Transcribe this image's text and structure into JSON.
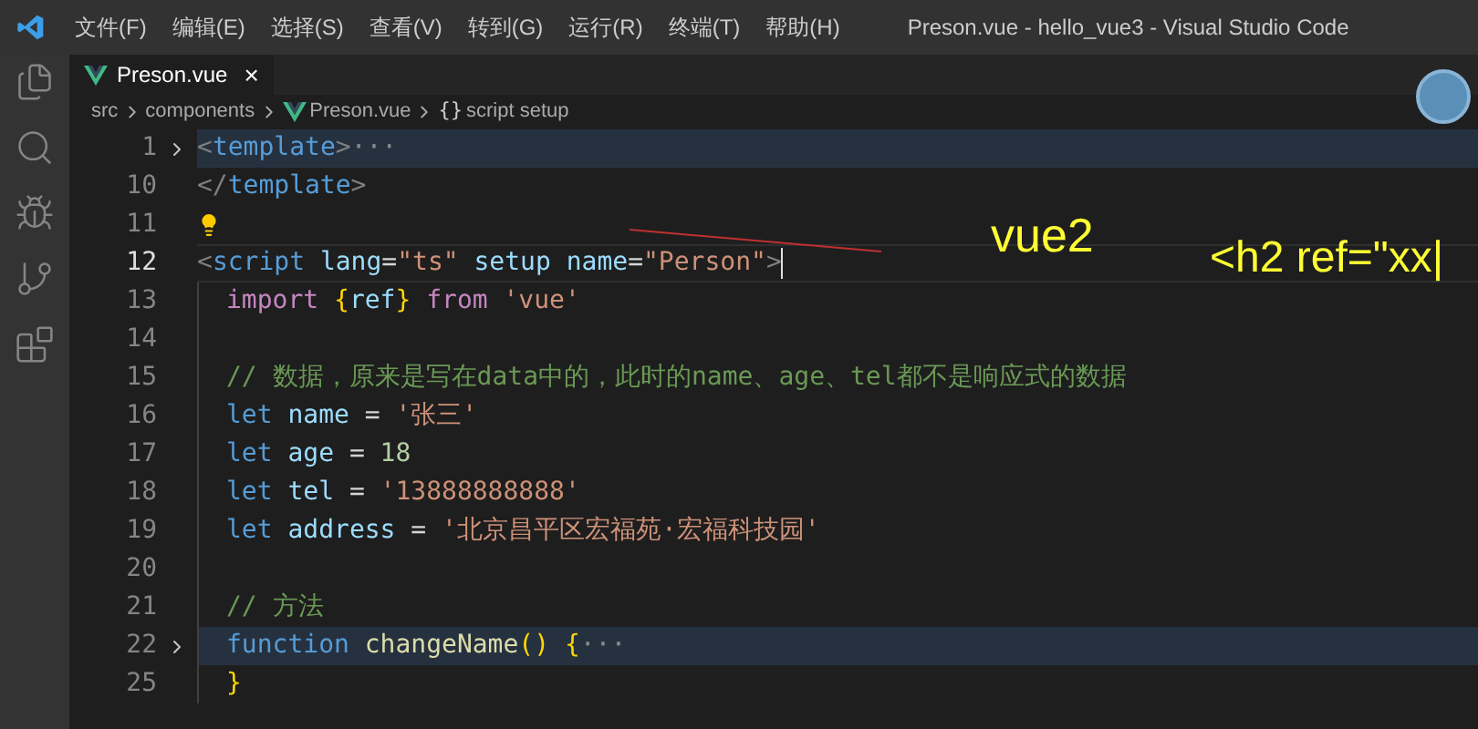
{
  "menu": [
    "文件(F)",
    "编辑(E)",
    "选择(S)",
    "查看(V)",
    "转到(G)",
    "运行(R)",
    "终端(T)",
    "帮助(H)"
  ],
  "window": {
    "title": "Preson.vue - hello_vue3 - Visual Studio Code"
  },
  "tabs": [
    {
      "label": "Preson.vue",
      "selected": true,
      "close": "×"
    }
  ],
  "breadcrumb": [
    {
      "kind": "folder",
      "label": "src"
    },
    {
      "kind": "folder",
      "label": "components"
    },
    {
      "kind": "vue",
      "label": "Preson.vue"
    },
    {
      "kind": "symbol",
      "label": "script setup",
      "glyph": "{}"
    }
  ],
  "lines": [
    {
      "number": "1",
      "fold": true,
      "current": false,
      "indent": false,
      "bulb": false,
      "tokens": [
        {
          "kind": "punct",
          "text": "<"
        },
        {
          "kind": "tag",
          "text": "template"
        },
        {
          "kind": "punct",
          "text": ">"
        },
        {
          "kind": "ellipsis",
          "text": "···"
        }
      ]
    },
    {
      "number": "10",
      "fold": false,
      "current": false,
      "indent": false,
      "bulb": false,
      "tokens": [
        {
          "kind": "punct",
          "text": "</"
        },
        {
          "kind": "tag",
          "text": "template"
        },
        {
          "kind": "punct",
          "text": ">"
        }
      ]
    },
    {
      "number": "11",
      "fold": false,
      "current": false,
      "indent": false,
      "bulb": true
    },
    {
      "number": "12",
      "fold": false,
      "current": true,
      "indent": false,
      "bulb": false,
      "tokens": [
        {
          "kind": "punct",
          "text": "<"
        },
        {
          "kind": "tag",
          "text": "script"
        },
        {
          "kind": "attr",
          "text": " lang"
        },
        {
          "kind": "plain",
          "text": "="
        },
        {
          "kind": "string",
          "text": "\"ts\""
        },
        {
          "kind": "attr",
          "text": " setup"
        },
        {
          "kind": "attr",
          "text": " name"
        },
        {
          "kind": "plain",
          "text": "="
        },
        {
          "kind": "string",
          "text": "\"Person\""
        },
        {
          "kind": "punct",
          "text": ">"
        }
      ]
    },
    {
      "number": "13",
      "fold": false,
      "current": false,
      "indent": true,
      "bulb": false,
      "tokens": [
        {
          "kind": "keyword",
          "text": "import"
        },
        {
          "kind": "bracket",
          "text": " {"
        },
        {
          "kind": "var",
          "text": "ref"
        },
        {
          "kind": "bracket",
          "text": "}"
        },
        {
          "kind": "keyword",
          "text": " from"
        },
        {
          "kind": "string",
          "text": " 'vue'"
        }
      ]
    },
    {
      "number": "14",
      "fold": false,
      "current": false,
      "indent": true,
      "bulb": false
    },
    {
      "number": "15",
      "fold": false,
      "current": false,
      "indent": true,
      "bulb": false,
      "tokens": [
        {
          "kind": "comment",
          "text": "// 数据，原来是写在data中的，此时的name、age、tel都不是响应式的数据"
        }
      ]
    },
    {
      "number": "16",
      "fold": false,
      "current": false,
      "indent": true,
      "bulb": false,
      "tokens": [
        {
          "kind": "storage",
          "text": "let"
        },
        {
          "kind": "var",
          "text": " name"
        },
        {
          "kind": "plain",
          "text": " ="
        },
        {
          "kind": "string",
          "text": " '张三'"
        }
      ]
    },
    {
      "number": "17",
      "fold": false,
      "current": false,
      "indent": true,
      "bulb": false,
      "tokens": [
        {
          "kind": "storage",
          "text": "let"
        },
        {
          "kind": "var",
          "text": " age"
        },
        {
          "kind": "plain",
          "text": " ="
        },
        {
          "kind": "number",
          "text": " 18"
        }
      ]
    },
    {
      "number": "18",
      "fold": false,
      "current": false,
      "indent": true,
      "bulb": false,
      "tokens": [
        {
          "kind": "storage",
          "text": "let"
        },
        {
          "kind": "var",
          "text": " tel"
        },
        {
          "kind": "plain",
          "text": " ="
        },
        {
          "kind": "string",
          "text": " '13888888888'"
        }
      ]
    },
    {
      "number": "19",
      "fold": false,
      "current": false,
      "indent": true,
      "bulb": false,
      "tokens": [
        {
          "kind": "storage",
          "text": "let"
        },
        {
          "kind": "var",
          "text": " address"
        },
        {
          "kind": "plain",
          "text": " ="
        },
        {
          "kind": "string",
          "text": " '北京昌平区宏福苑·宏福科技园'"
        }
      ]
    },
    {
      "number": "20",
      "fold": false,
      "current": false,
      "indent": true,
      "bulb": false
    },
    {
      "number": "21",
      "fold": false,
      "current": false,
      "indent": true,
      "bulb": false,
      "tokens": [
        {
          "kind": "comment",
          "text": "// 方法"
        }
      ]
    },
    {
      "number": "22",
      "fold": true,
      "current": false,
      "indent": true,
      "bulb": false,
      "tokens": [
        {
          "kind": "storage",
          "text": "function"
        },
        {
          "kind": "func",
          "text": " changeName"
        },
        {
          "kind": "bracket",
          "text": "()"
        },
        {
          "kind": "bracket",
          "text": " {"
        },
        {
          "kind": "ellipsis",
          "text": "···"
        }
      ]
    },
    {
      "number": "25",
      "fold": false,
      "current": false,
      "indent": true,
      "bulb": false,
      "tokens": [
        {
          "kind": "bracket",
          "text": "}"
        }
      ]
    }
  ],
  "annotations": [
    {
      "kind": "note",
      "text": "vue2"
    },
    {
      "kind": "code",
      "text": "<h2 ref=\"xx|"
    }
  ]
}
